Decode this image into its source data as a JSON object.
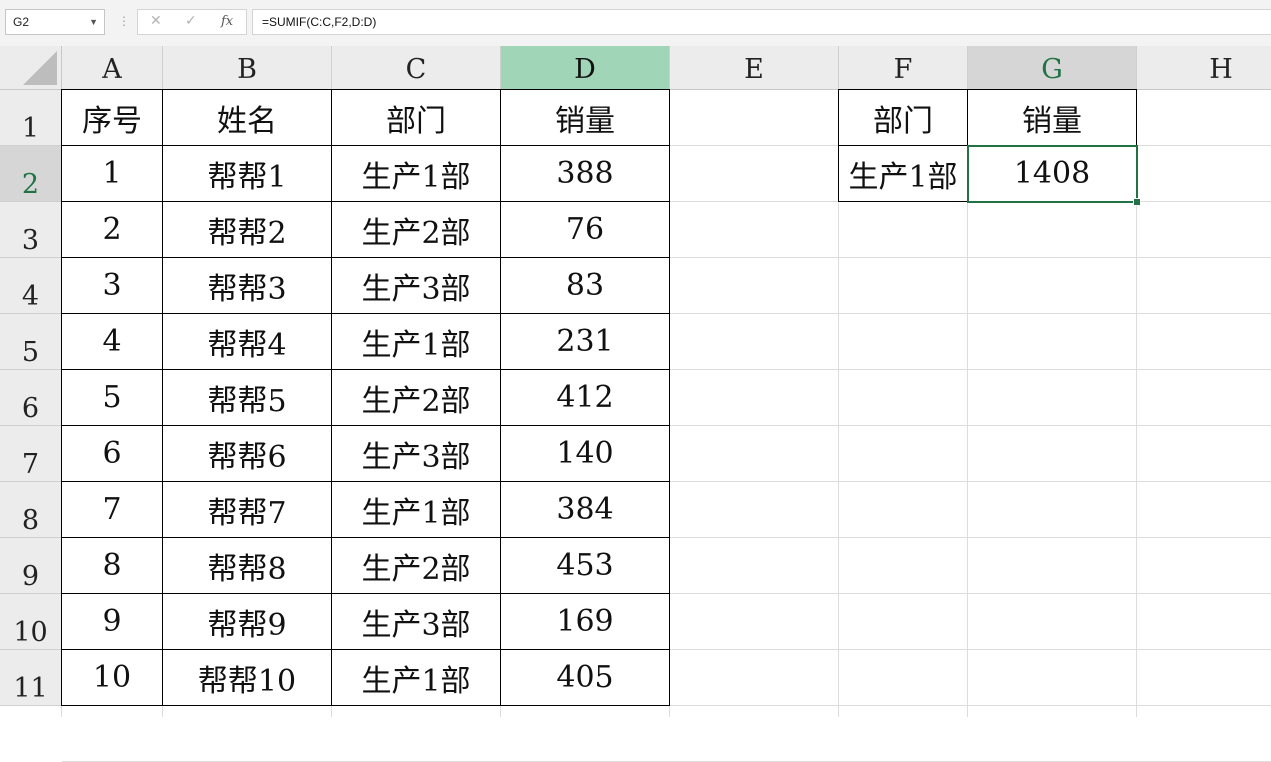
{
  "formula_bar": {
    "name_box": "G2",
    "formula": "=SUMIF(C:C,F2,D:D)"
  },
  "columns": [
    "A",
    "B",
    "C",
    "D",
    "E",
    "F",
    "G",
    "H"
  ],
  "rows": [
    "1",
    "2",
    "3",
    "4",
    "5",
    "6",
    "7",
    "8",
    "9",
    "10",
    "11"
  ],
  "table": {
    "headers": [
      "序号",
      "姓名",
      "部门",
      "销量"
    ],
    "rows": [
      [
        "1",
        "帮帮1",
        "生产1部",
        "388"
      ],
      [
        "2",
        "帮帮2",
        "生产2部",
        "76"
      ],
      [
        "3",
        "帮帮3",
        "生产3部",
        "83"
      ],
      [
        "4",
        "帮帮4",
        "生产1部",
        "231"
      ],
      [
        "5",
        "帮帮5",
        "生产2部",
        "412"
      ],
      [
        "6",
        "帮帮6",
        "生产3部",
        "140"
      ],
      [
        "7",
        "帮帮7",
        "生产1部",
        "384"
      ],
      [
        "8",
        "帮帮8",
        "生产2部",
        "453"
      ],
      [
        "9",
        "帮帮9",
        "生产3部",
        "169"
      ],
      [
        "10",
        "帮帮10",
        "生产1部",
        "405"
      ]
    ]
  },
  "summary": {
    "header_dept": "部门",
    "header_sales": "销量",
    "dept": "生产1部",
    "sales": "1408"
  },
  "selection": {
    "cell": "G2",
    "column": "G",
    "row": "2"
  },
  "colors": {
    "selection": "#217346",
    "column_d_highlight": "#a0d5b8"
  }
}
